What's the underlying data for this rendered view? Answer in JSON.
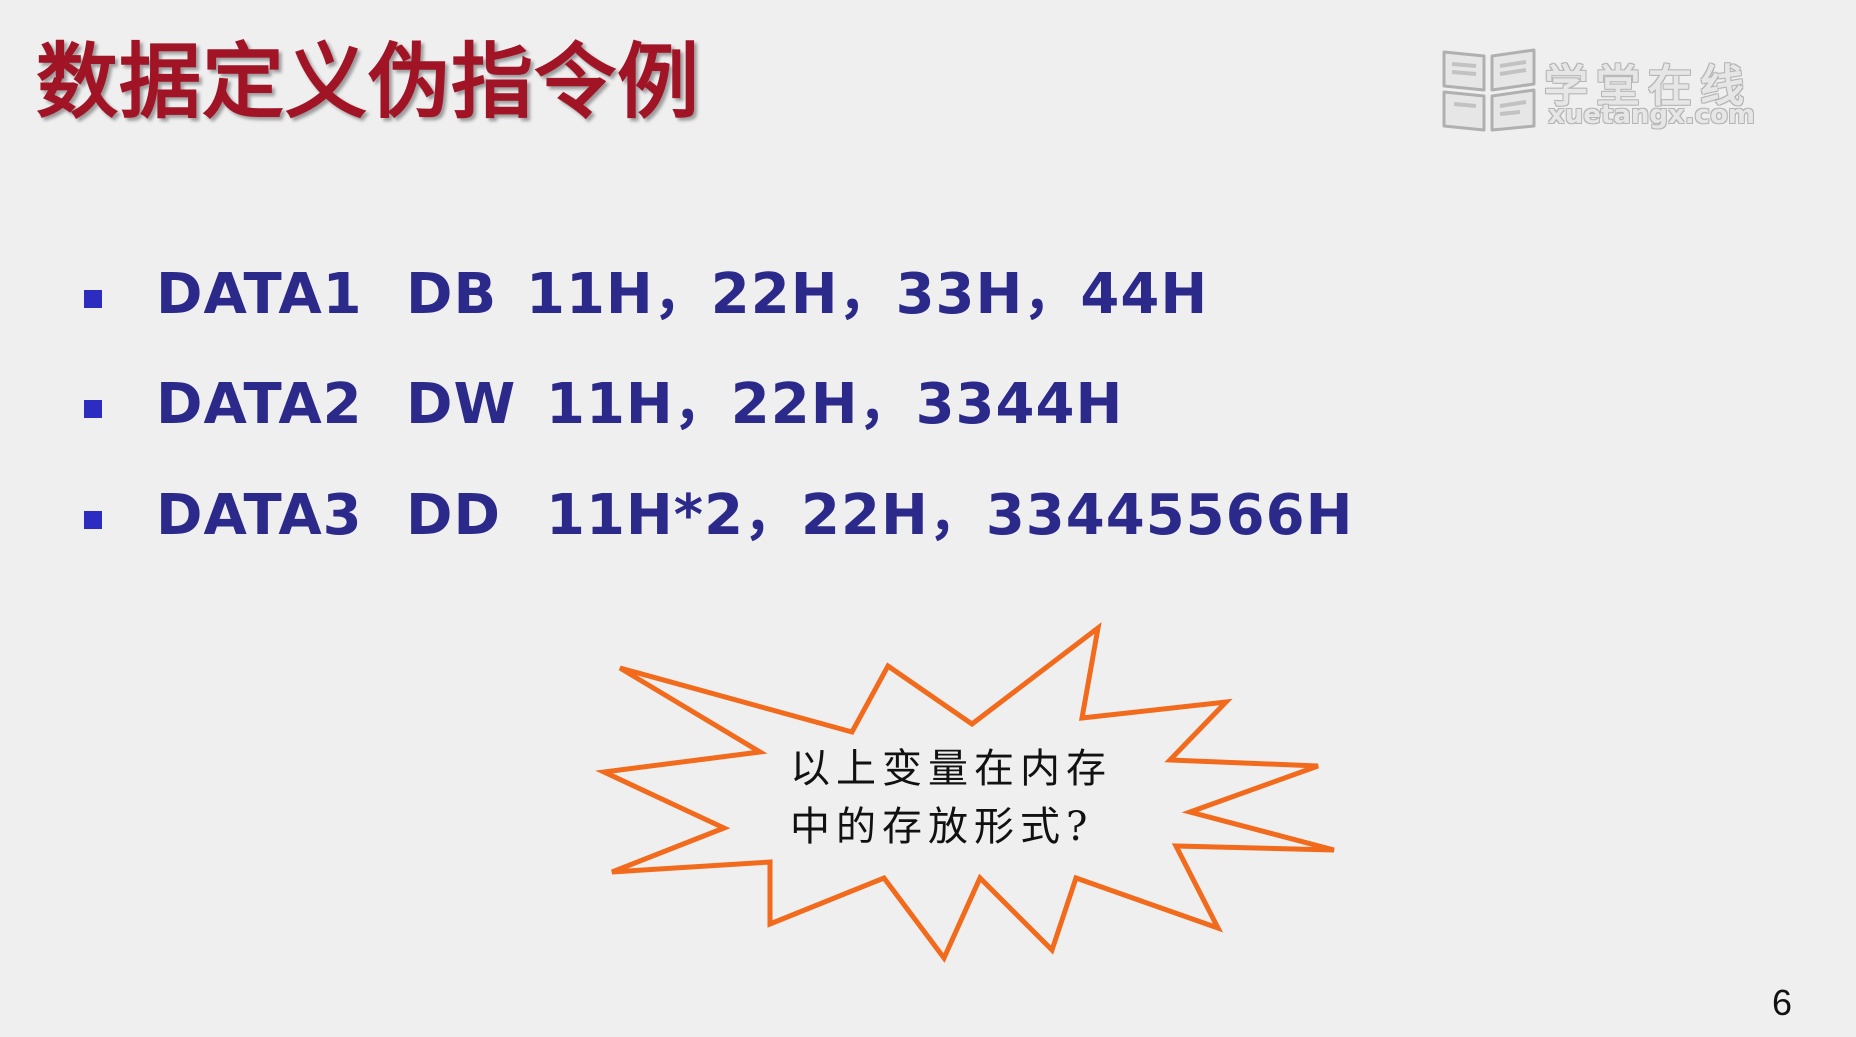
{
  "slide": {
    "title": "数据定义伪指令例",
    "watermark": {
      "name_cn": "学堂在线",
      "domain": "xuetangx.com",
      "icon": "book-logo-icon"
    },
    "items": [
      {
        "label": "DATA1",
        "directive": "DB",
        "operands": "11H，22H，33H，44H"
      },
      {
        "label": "DATA2",
        "directive": "DW",
        "operands": "11H，22H，3344H"
      },
      {
        "label": "DATA3",
        "directive": "DD",
        "operands": "11H*2，22H，33445566H"
      }
    ],
    "callout": {
      "line1": "以上变量在内存",
      "line2": "中的存放形式?"
    },
    "page_number": "6",
    "colors": {
      "title": "#a01426",
      "text": "#2b2a8a",
      "bullet": "#2c2cc0",
      "burst_stroke": "#f26a1b",
      "background": "#efefef"
    }
  }
}
